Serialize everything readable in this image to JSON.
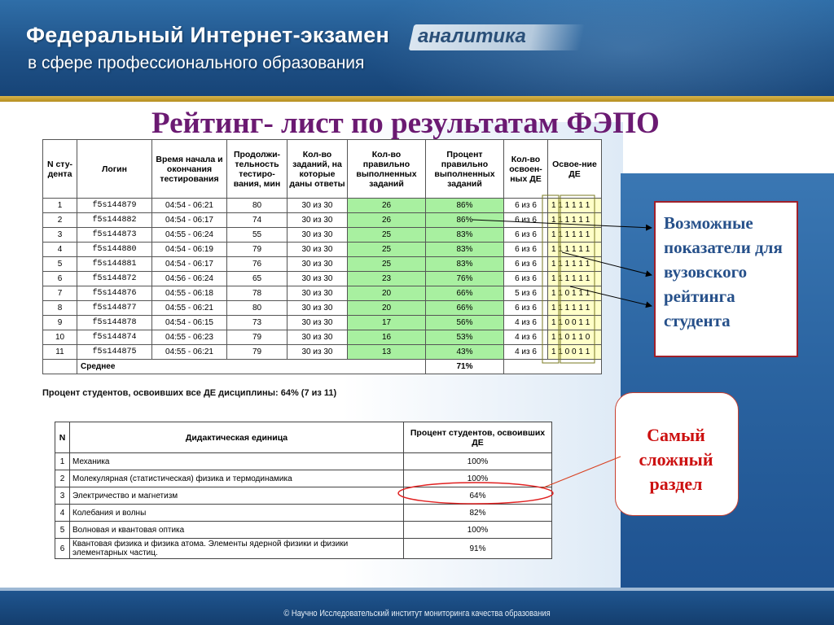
{
  "header": {
    "title": "Федеральный Интернет-экзамен",
    "subtitle": "в сфере профессионального образования",
    "badge": "аналитика"
  },
  "main_title": "Рейтинг- лист по результатам ФЭПО",
  "rating_table": {
    "headers": [
      "N сту-дента",
      "Логин",
      "Время начала и окончания тестирования",
      "Продолжи-тельность тестиро-вания, мин",
      "Кол-во заданий, на которые даны ответы",
      "Кол-во правильно выполненных заданий",
      "Процент правильно выполненных заданий",
      "Кол-во освоен-ных ДЕ",
      "Освое-ние ДЕ"
    ],
    "rows": [
      {
        "n": "1",
        "login": "f5s144879",
        "time": "04:54 - 06:21",
        "duration": "80",
        "answered": "30 из 30",
        "correct": "26",
        "percent": "86%",
        "de": "6 из 6",
        "mastery": "1 1 1 1 1 1"
      },
      {
        "n": "2",
        "login": "f5s144882",
        "time": "04:54 - 06:17",
        "duration": "74",
        "answered": "30 из 30",
        "correct": "26",
        "percent": "86%",
        "de": "6 из 6",
        "mastery": "1 1 1 1 1 1"
      },
      {
        "n": "3",
        "login": "f5s144873",
        "time": "04:55 - 06:24",
        "duration": "55",
        "answered": "30 из 30",
        "correct": "25",
        "percent": "83%",
        "de": "6 из 6",
        "mastery": "1 1 1 1 1 1"
      },
      {
        "n": "4",
        "login": "f5s144880",
        "time": "04:54 - 06:19",
        "duration": "79",
        "answered": "30 из 30",
        "correct": "25",
        "percent": "83%",
        "de": "6 из 6",
        "mastery": "1 1 1 1 1 1"
      },
      {
        "n": "5",
        "login": "f5s144881",
        "time": "04:54 - 06:17",
        "duration": "76",
        "answered": "30 из 30",
        "correct": "25",
        "percent": "83%",
        "de": "6 из 6",
        "mastery": "1 1 1 1 1 1"
      },
      {
        "n": "6",
        "login": "f5s144872",
        "time": "04:56 - 06:24",
        "duration": "65",
        "answered": "30 из 30",
        "correct": "23",
        "percent": "76%",
        "de": "6 из 6",
        "mastery": "1 1 1 1 1 1"
      },
      {
        "n": "7",
        "login": "f5s144876",
        "time": "04:55 - 06:18",
        "duration": "78",
        "answered": "30 из 30",
        "correct": "20",
        "percent": "66%",
        "de": "5 из 6",
        "mastery": "1 1 0 1 1 1"
      },
      {
        "n": "8",
        "login": "f5s144877",
        "time": "04:55 - 06:21",
        "duration": "80",
        "answered": "30 из 30",
        "correct": "20",
        "percent": "66%",
        "de": "6 из 6",
        "mastery": "1 1 1 1 1 1"
      },
      {
        "n": "9",
        "login": "f5s144878",
        "time": "04:54 - 06:15",
        "duration": "73",
        "answered": "30 из 30",
        "correct": "17",
        "percent": "56%",
        "de": "4 из 6",
        "mastery": "1 1 0 0 1 1"
      },
      {
        "n": "10",
        "login": "f5s144874",
        "time": "04:55 - 06:23",
        "duration": "79",
        "answered": "30 из 30",
        "correct": "16",
        "percent": "53%",
        "de": "4 из 6",
        "mastery": "1 1 0 1 1 0"
      },
      {
        "n": "11",
        "login": "f5s144875",
        "time": "04:55 - 06:21",
        "duration": "79",
        "answered": "30 из 30",
        "correct": "13",
        "percent": "43%",
        "de": "4 из 6",
        "mastery": "1 1 0 0 1 1"
      }
    ],
    "average_label": "Среднее",
    "average_percent": "71%"
  },
  "summary_text": "Процент студентов, освоивших все ДЕ дисциплины: 64% (7 из 11)",
  "de_table": {
    "headers": [
      "N",
      "Дидактическая единица",
      "Процент студентов, освоивших ДЕ"
    ],
    "rows": [
      {
        "n": "1",
        "name": "Механика",
        "percent": "100%"
      },
      {
        "n": "2",
        "name": "Молекулярная (статистическая) физика и термодинамика",
        "percent": "100%"
      },
      {
        "n": "3",
        "name": "Электричество и магнетизм",
        "percent": "64%"
      },
      {
        "n": "4",
        "name": "Колебания и волны",
        "percent": "82%"
      },
      {
        "n": "5",
        "name": "Волновая и квантовая оптика",
        "percent": "100%"
      },
      {
        "n": "6",
        "name": "Квантовая физика и физика атома. Элементы ядерной физики и физики элементарных частиц.",
        "percent": "91%"
      }
    ]
  },
  "callout": "Возможные показатели для вузовского рейтинга студента",
  "hardest": "Самый сложный раздел",
  "footer": "© Научно Исследовательский институт мониторинга качества образования",
  "colors": {
    "title": "#6b1a72",
    "callout_text": "#26508a",
    "hardest_text": "#cc1010",
    "green_cells": "#a8f0a0",
    "yellow_cells": "#ffffc8"
  }
}
